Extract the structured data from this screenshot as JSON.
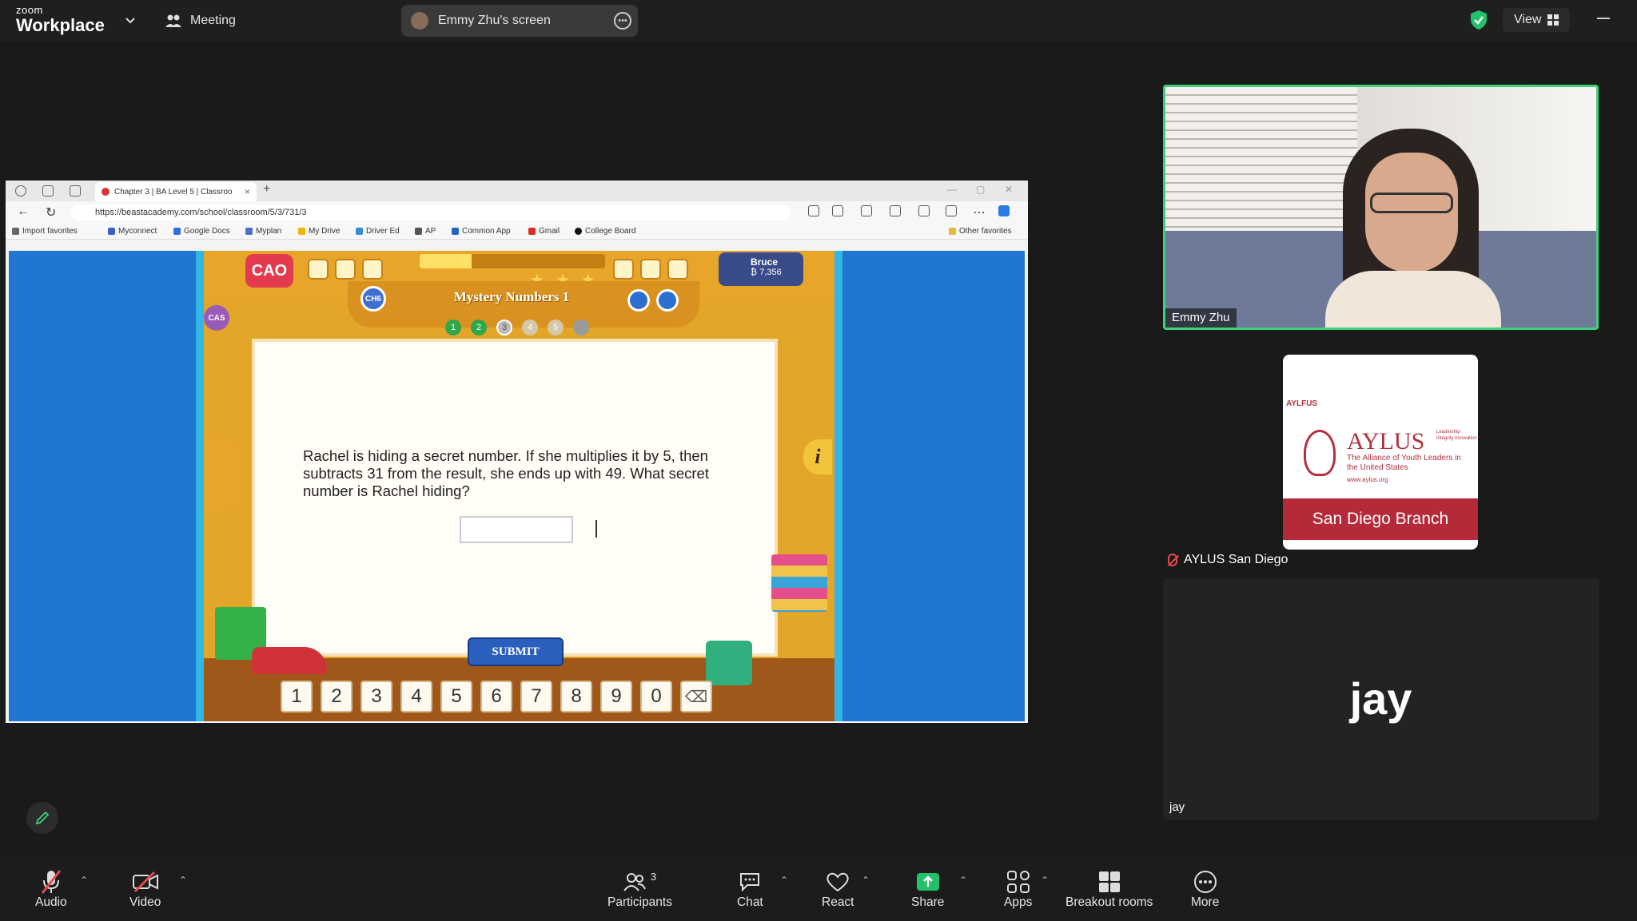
{
  "topbar": {
    "logo_small": "zoom",
    "logo_big": "Workplace",
    "meeting_label": "Meeting",
    "screen_label": "Emmy Zhu's screen",
    "view_label": "View"
  },
  "browser": {
    "tab_title": "Chapter 3 | BA Level 5 | Classroo",
    "url": "https://beastacademy.com/school/classroom/5/3/731/3",
    "bookmarks": [
      "Import favorites",
      "Myconnect",
      "Google Docs",
      "Myplan",
      "My Drive",
      "Driver Ed",
      "AP",
      "Common App",
      "Gmail",
      "College Board"
    ],
    "other_favorites": "Other favorites"
  },
  "game": {
    "logo": "CAO",
    "user_name": "Bruce",
    "user_points": "₿ 7,356",
    "chapter_badge": "CH6",
    "side_badge": "CAS",
    "title": "Mystery Numbers 1",
    "steps": [
      "1",
      "2",
      "3",
      "4",
      "5"
    ],
    "progress": 0.28,
    "question": "Rachel is hiding a secret number. If she multiplies it by 5, then subtracts 31 from the result, she ends up with 49. What secret number is Rachel hiding?",
    "submit_label": "SUBMIT",
    "info_label": "i",
    "keys": [
      "1",
      "2",
      "3",
      "4",
      "5",
      "6",
      "7",
      "8",
      "9",
      "0"
    ],
    "backspace": "⌫"
  },
  "participants": {
    "emmy": "Emmy Zhu",
    "aylus_label": "AYLUS San Diego",
    "aylus_small": "AYLFUS",
    "aylus_name": "AYLUS",
    "aylus_tagline": "The Alliance of Youth Leaders in the United States",
    "aylus_web": "www.aylus.org",
    "aylus_motto": "Leadership Integrity Innovation",
    "aylus_branch": "San Diego Branch",
    "jay_big": "jay",
    "jay_label": "jay"
  },
  "toolbar": {
    "audio": "Audio",
    "video": "Video",
    "participants": "Participants",
    "participants_count": "3",
    "chat": "Chat",
    "react": "React",
    "share": "Share",
    "apps": "Apps",
    "breakout": "Breakout rooms",
    "more": "More"
  },
  "colors": {
    "share_green": "#23c16b",
    "active_speaker": "#3fd17a",
    "muted_red": "#e24b4b",
    "aylus_red": "#b62938"
  }
}
